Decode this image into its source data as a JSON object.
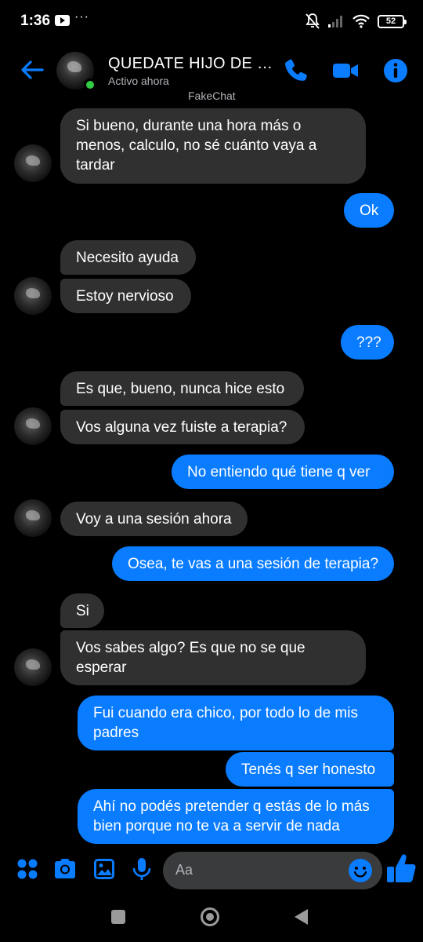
{
  "status_bar": {
    "time": "1:36",
    "dots": "···",
    "battery": "52"
  },
  "header": {
    "contact_name": "QUEDATE HIJO DE PU...",
    "contact_status": "Activo ahora",
    "watermark": "FakeChat"
  },
  "messages": [
    {
      "from": "them",
      "lines": [
        "Si bueno, durante una hora más o",
        "menos, calculo, no sé cuánto vaya a",
        "tardar"
      ]
    },
    {
      "from": "me",
      "lines": [
        "Ok"
      ]
    },
    {
      "from": "them",
      "lines": [
        "Necesito ayuda"
      ]
    },
    {
      "from": "them",
      "lines": [
        "Estoy nervioso"
      ]
    },
    {
      "from": "me",
      "lines": [
        "???"
      ]
    },
    {
      "from": "them",
      "lines": [
        "Es que, bueno, nunca hice esto"
      ]
    },
    {
      "from": "them",
      "lines": [
        "Vos alguna vez fuiste a terapia?"
      ]
    },
    {
      "from": "me",
      "lines": [
        "No entiendo qué tiene q ver"
      ]
    },
    {
      "from": "them",
      "lines": [
        "Voy a una sesión ahora"
      ]
    },
    {
      "from": "me",
      "lines": [
        "Osea, te vas a una sesión de terapia?"
      ]
    },
    {
      "from": "them",
      "lines": [
        "Si"
      ]
    },
    {
      "from": "them",
      "lines": [
        "Vos sabes algo? Es que no se que",
        "esperar"
      ]
    },
    {
      "from": "me",
      "lines": [
        "Fui cuando era chico, por todo lo de mis",
        "padres"
      ]
    },
    {
      "from": "me",
      "lines": [
        "Tenés q ser honesto"
      ]
    },
    {
      "from": "me",
      "lines": [
        "Ahí no podés pretender q estás de lo más",
        "bien porque no te va a servir de nada"
      ]
    }
  ],
  "composer": {
    "placeholder": "Aa"
  },
  "colors": {
    "accent": "#0a7cff",
    "incoming_bubble": "#303030",
    "online": "#31cc46"
  },
  "icons": [
    "back-arrow-icon",
    "phone-icon",
    "video-camera-icon",
    "info-icon",
    "apps-icon",
    "camera-icon",
    "image-icon",
    "microphone-icon",
    "emoji-icon",
    "thumbs-up-icon"
  ]
}
